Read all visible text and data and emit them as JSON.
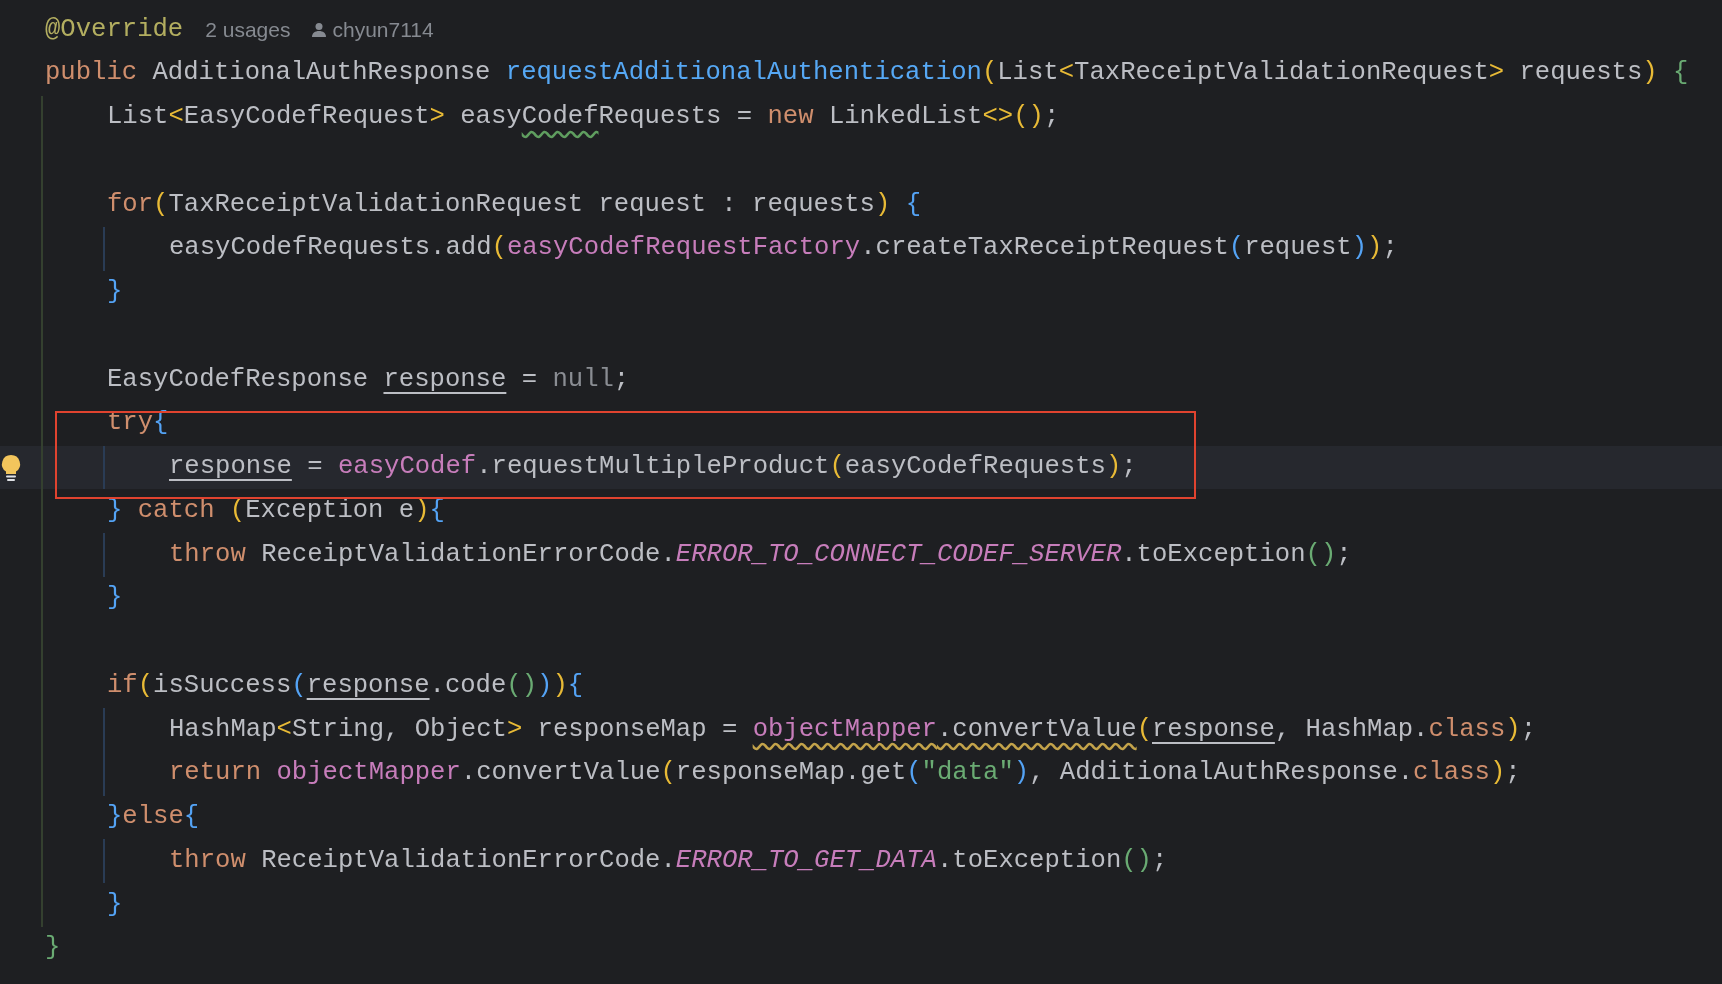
{
  "editor": {
    "lines": [
      {
        "kind": "code",
        "current": false,
        "tokens": [
          {
            "kind": "annotation",
            "text": "@Override"
          }
        ],
        "hints": {
          "usages": "2 usages",
          "author": "chyun7114"
        }
      },
      {
        "kind": "code",
        "current": false,
        "tokens": [
          {
            "kind": "keyword",
            "text": "public"
          },
          {
            "kind": "plain",
            "text": " AdditionalAuthResponse "
          },
          {
            "kind": "method",
            "text": "requestAdditionalAuthentication"
          },
          {
            "kind": "bracket1",
            "text": "("
          },
          {
            "kind": "plain",
            "text": "List"
          },
          {
            "kind": "bracket1",
            "text": "<"
          },
          {
            "kind": "plain",
            "text": "TaxReceiptValidationRequest"
          },
          {
            "kind": "bracket1",
            "text": ">"
          },
          {
            "kind": "plain",
            "text": " requests"
          },
          {
            "kind": "bracket1",
            "text": ")"
          },
          {
            "kind": "bracket3",
            "text": " {"
          }
        ],
        "children": [
          {
            "kind": "code",
            "current": false,
            "tokens": [
              {
                "kind": "plain",
                "text": "List"
              },
              {
                "kind": "bracket1",
                "text": "<"
              },
              {
                "kind": "plain",
                "text": "EasyCodefRequest"
              },
              {
                "kind": "bracket1",
                "text": ">"
              },
              {
                "kind": "plain",
                "text": " easy"
              },
              {
                "kind": "typo",
                "text": "Codef"
              },
              {
                "kind": "plain",
                "text": "Requests = "
              },
              {
                "kind": "keyword",
                "text": "new"
              },
              {
                "kind": "plain",
                "text": " LinkedList"
              },
              {
                "kind": "bracket1",
                "text": "<>()"
              },
              {
                "kind": "plain",
                "text": ";"
              }
            ]
          },
          {
            "kind": "blank"
          },
          {
            "kind": "code",
            "current": false,
            "tokens": [
              {
                "kind": "keyword",
                "text": "for"
              },
              {
                "kind": "bracket1",
                "text": "("
              },
              {
                "kind": "plain",
                "text": "TaxReceiptValidationRequest request : requests"
              },
              {
                "kind": "bracket1",
                "text": ")"
              },
              {
                "kind": "bracket2",
                "text": " {"
              }
            ],
            "children": [
              {
                "kind": "code",
                "current": false,
                "tokens": [
                  {
                    "kind": "plain",
                    "text": "easyCodefRequests.add"
                  },
                  {
                    "kind": "bracket1",
                    "text": "("
                  },
                  {
                    "kind": "field",
                    "text": "easyCodefRequestFactory"
                  },
                  {
                    "kind": "plain",
                    "text": ".createTaxReceiptRequest"
                  },
                  {
                    "kind": "bracket2",
                    "text": "("
                  },
                  {
                    "kind": "plain",
                    "text": "request"
                  },
                  {
                    "kind": "bracket2",
                    "text": ")"
                  },
                  {
                    "kind": "bracket1",
                    "text": ")"
                  },
                  {
                    "kind": "plain",
                    "text": ";"
                  }
                ]
              }
            ]
          },
          {
            "kind": "code",
            "current": false,
            "tokens": [
              {
                "kind": "bracket2",
                "text": "}"
              }
            ]
          },
          {
            "kind": "blank"
          },
          {
            "kind": "code",
            "current": false,
            "tokens": [
              {
                "kind": "plain",
                "text": "EasyCodefResponse "
              },
              {
                "kind": "reassigned",
                "text": "response"
              },
              {
                "kind": "plain",
                "text": " = "
              },
              {
                "kind": "null",
                "text": "null"
              },
              {
                "kind": "plain",
                "text": ";"
              }
            ]
          },
          {
            "kind": "code",
            "current": false,
            "tokens": [
              {
                "kind": "keyword",
                "text": "try"
              },
              {
                "kind": "bracket2",
                "text": "{"
              }
            ],
            "children": [
              {
                "kind": "code",
                "current": true,
                "tokens": [
                  {
                    "kind": "reassigned",
                    "text": "response"
                  },
                  {
                    "kind": "plain",
                    "text": " = "
                  },
                  {
                    "kind": "field",
                    "text": "easyCodef"
                  },
                  {
                    "kind": "plain",
                    "text": ".requestMultipleProduct"
                  },
                  {
                    "kind": "bracket1",
                    "text": "("
                  },
                  {
                    "kind": "plain",
                    "text": "easyCodefRequests"
                  },
                  {
                    "kind": "bracket1",
                    "text": ")"
                  },
                  {
                    "kind": "plain",
                    "text": ";"
                  }
                ]
              }
            ]
          },
          {
            "kind": "code",
            "current": false,
            "tokens": [
              {
                "kind": "bracket2",
                "text": "}"
              },
              {
                "kind": "keyword",
                "text": " catch"
              },
              {
                "kind": "bracket1",
                "text": " ("
              },
              {
                "kind": "plain",
                "text": "Exception e"
              },
              {
                "kind": "bracket1",
                "text": ")"
              },
              {
                "kind": "bracket2",
                "text": "{"
              }
            ],
            "children": [
              {
                "kind": "code",
                "current": false,
                "tokens": [
                  {
                    "kind": "keyword",
                    "text": "throw"
                  },
                  {
                    "kind": "plain",
                    "text": " ReceiptValidationErrorCode."
                  },
                  {
                    "kind": "constant",
                    "text": "ERROR_TO_CONNECT_CODEF_SERVER"
                  },
                  {
                    "kind": "plain",
                    "text": ".toException"
                  },
                  {
                    "kind": "bracket3",
                    "text": "()"
                  },
                  {
                    "kind": "plain",
                    "text": ";"
                  }
                ]
              }
            ]
          },
          {
            "kind": "code",
            "current": false,
            "tokens": [
              {
                "kind": "bracket2",
                "text": "}"
              }
            ]
          },
          {
            "kind": "blank"
          },
          {
            "kind": "code",
            "current": false,
            "tokens": [
              {
                "kind": "keyword",
                "text": "if"
              },
              {
                "kind": "bracket1",
                "text": "("
              },
              {
                "kind": "plain",
                "text": "isSuccess"
              },
              {
                "kind": "bracket2",
                "text": "("
              },
              {
                "kind": "reassigned",
                "text": "response"
              },
              {
                "kind": "plain",
                "text": ".code"
              },
              {
                "kind": "bracket3",
                "text": "()"
              },
              {
                "kind": "bracket2",
                "text": ")"
              },
              {
                "kind": "bracket1",
                "text": ")"
              },
              {
                "kind": "bracket2",
                "text": "{"
              }
            ],
            "children": [
              {
                "kind": "code",
                "current": false,
                "tokens": [
                  {
                    "kind": "plain",
                    "text": "HashMap"
                  },
                  {
                    "kind": "bracket1",
                    "text": "<"
                  },
                  {
                    "kind": "plain",
                    "text": "String, Object"
                  },
                  {
                    "kind": "bracket1",
                    "text": ">"
                  },
                  {
                    "kind": "plain",
                    "text": " responseMap = "
                  },
                  {
                    "kind": "field-warning",
                    "text": "objectMapper"
                  },
                  {
                    "kind": "plain-warning",
                    "text": ".convertValue"
                  },
                  {
                    "kind": "bracket1",
                    "text": "("
                  },
                  {
                    "kind": "reassigned",
                    "text": "response"
                  },
                  {
                    "kind": "plain",
                    "text": ", HashMap."
                  },
                  {
                    "kind": "keyword",
                    "text": "class"
                  },
                  {
                    "kind": "bracket1",
                    "text": ")"
                  },
                  {
                    "kind": "plain",
                    "text": ";"
                  }
                ]
              },
              {
                "kind": "code",
                "current": false,
                "tokens": [
                  {
                    "kind": "keyword",
                    "text": "return "
                  },
                  {
                    "kind": "field",
                    "text": "objectMapper"
                  },
                  {
                    "kind": "plain",
                    "text": ".convertValue"
                  },
                  {
                    "kind": "bracket1",
                    "text": "("
                  },
                  {
                    "kind": "plain",
                    "text": "responseMap.get"
                  },
                  {
                    "kind": "bracket2",
                    "text": "("
                  },
                  {
                    "kind": "string",
                    "text": "\"data\""
                  },
                  {
                    "kind": "bracket2",
                    "text": ")"
                  },
                  {
                    "kind": "plain",
                    "text": ", AdditionalAuthResponse."
                  },
                  {
                    "kind": "keyword",
                    "text": "class"
                  },
                  {
                    "kind": "bracket1",
                    "text": ")"
                  },
                  {
                    "kind": "plain",
                    "text": ";"
                  }
                ]
              }
            ]
          },
          {
            "kind": "code",
            "current": false,
            "tokens": [
              {
                "kind": "bracket2",
                "text": "}"
              },
              {
                "kind": "keyword",
                "text": "else"
              },
              {
                "kind": "bracket2",
                "text": "{"
              }
            ],
            "children": [
              {
                "kind": "code",
                "current": false,
                "tokens": [
                  {
                    "kind": "keyword",
                    "text": "throw"
                  },
                  {
                    "kind": "plain",
                    "text": " ReceiptValidationErrorCode."
                  },
                  {
                    "kind": "constant",
                    "text": "ERROR_TO_GET_DATA"
                  },
                  {
                    "kind": "plain",
                    "text": ".toException"
                  },
                  {
                    "kind": "bracket3",
                    "text": "()"
                  },
                  {
                    "kind": "plain",
                    "text": ";"
                  }
                ]
              }
            ]
          },
          {
            "kind": "code",
            "current": false,
            "tokens": [
              {
                "kind": "bracket2",
                "text": "}"
              }
            ]
          }
        ]
      },
      {
        "kind": "code",
        "current": false,
        "tokens": [
          {
            "kind": "bracket3",
            "text": "}"
          }
        ]
      }
    ]
  }
}
